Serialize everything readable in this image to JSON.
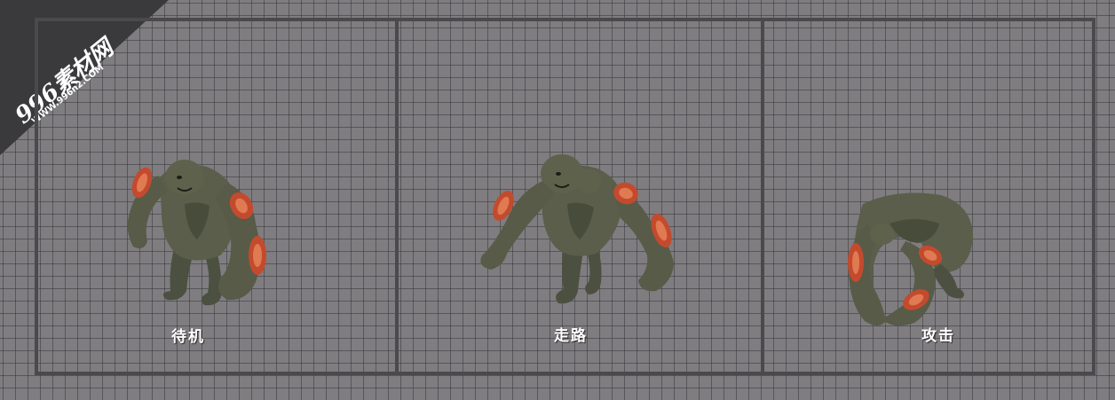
{
  "watermark": {
    "main_text": "996素材网",
    "sub_text": "WWW.996n2.COM"
  },
  "panels": [
    {
      "label": "待机",
      "icon": "idle-monster-icon"
    },
    {
      "label": "走路",
      "icon": "walk-monster-icon"
    },
    {
      "label": "攻击",
      "icon": "attack-monster-icon"
    }
  ],
  "colors": {
    "background": "#7f7d80",
    "grid_line": "#37373a",
    "frame_border": "#4a494c",
    "monster_skin": "#5a5e4a",
    "monster_shoulder": "#c44a2e",
    "label_text": "#ffffff"
  }
}
